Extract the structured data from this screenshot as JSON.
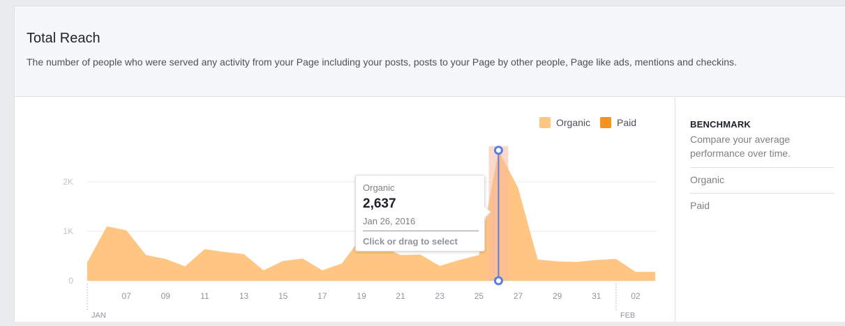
{
  "card": {
    "title": "Total Reach",
    "description": "The number of people who were served any activity from your Page including your posts, posts to your Page by other people, Page like ads, mentions and checkins."
  },
  "legend": [
    {
      "label": "Organic",
      "color": "#ffc582"
    },
    {
      "label": "Paid",
      "color": "#f6921e"
    }
  ],
  "benchmark": {
    "title": "BENCHMARK",
    "description": "Compare your average performance over time.",
    "items": [
      "Organic",
      "Paid"
    ]
  },
  "tooltip": {
    "series": "Organic",
    "value": "2,637",
    "date": "Jan 26, 2016",
    "hint": "Click or drag to select"
  },
  "colors": {
    "organic": "#ffc582",
    "paid": "#f6921e",
    "marker": "#5b7ee5",
    "highlight": "#f7b9a0"
  },
  "chart_data": {
    "type": "area",
    "series": [
      {
        "name": "Organic",
        "x": [
          "Jan 5",
          "Jan 6",
          "Jan 7",
          "Jan 8",
          "Jan 9",
          "Jan 10",
          "Jan 11",
          "Jan 12",
          "Jan 13",
          "Jan 14",
          "Jan 15",
          "Jan 16",
          "Jan 17",
          "Jan 18",
          "Jan 19",
          "Jan 20",
          "Jan 21",
          "Jan 22",
          "Jan 23",
          "Jan 24",
          "Jan 25",
          "Jan 26",
          "Jan 27",
          "Jan 28",
          "Jan 29",
          "Jan 30",
          "Jan 31",
          "Feb 1",
          "Feb 2",
          "Feb 3"
        ],
        "values": [
          370,
          1100,
          1020,
          520,
          440,
          290,
          640,
          580,
          540,
          210,
          400,
          450,
          210,
          350,
          880,
          700,
          520,
          530,
          300,
          420,
          520,
          2637,
          1880,
          430,
          390,
          380,
          420,
          440,
          180,
          180
        ]
      }
    ],
    "y_ticks": [
      "0",
      "1K",
      "2K"
    ],
    "y_tick_values": [
      0,
      1000,
      2000
    ],
    "ylim": [
      0,
      2850
    ],
    "x_ticks": [
      "07",
      "09",
      "11",
      "13",
      "15",
      "17",
      "19",
      "21",
      "23",
      "25",
      "27",
      "29",
      "31",
      "02"
    ],
    "x_tick_dates": [
      "Jan 7",
      "Jan 9",
      "Jan 11",
      "Jan 13",
      "Jan 15",
      "Jan 17",
      "Jan 19",
      "Jan 21",
      "Jan 23",
      "Jan 25",
      "Jan 27",
      "Jan 29",
      "Jan 31",
      "Feb 2"
    ],
    "month_labels": [
      {
        "label": "JAN",
        "date": "Jan 5"
      },
      {
        "label": "FEB",
        "date": "Feb 1"
      }
    ],
    "selected": {
      "date": "Jan 26",
      "value": 2637
    },
    "grid": true,
    "legend_position": "top-right"
  }
}
